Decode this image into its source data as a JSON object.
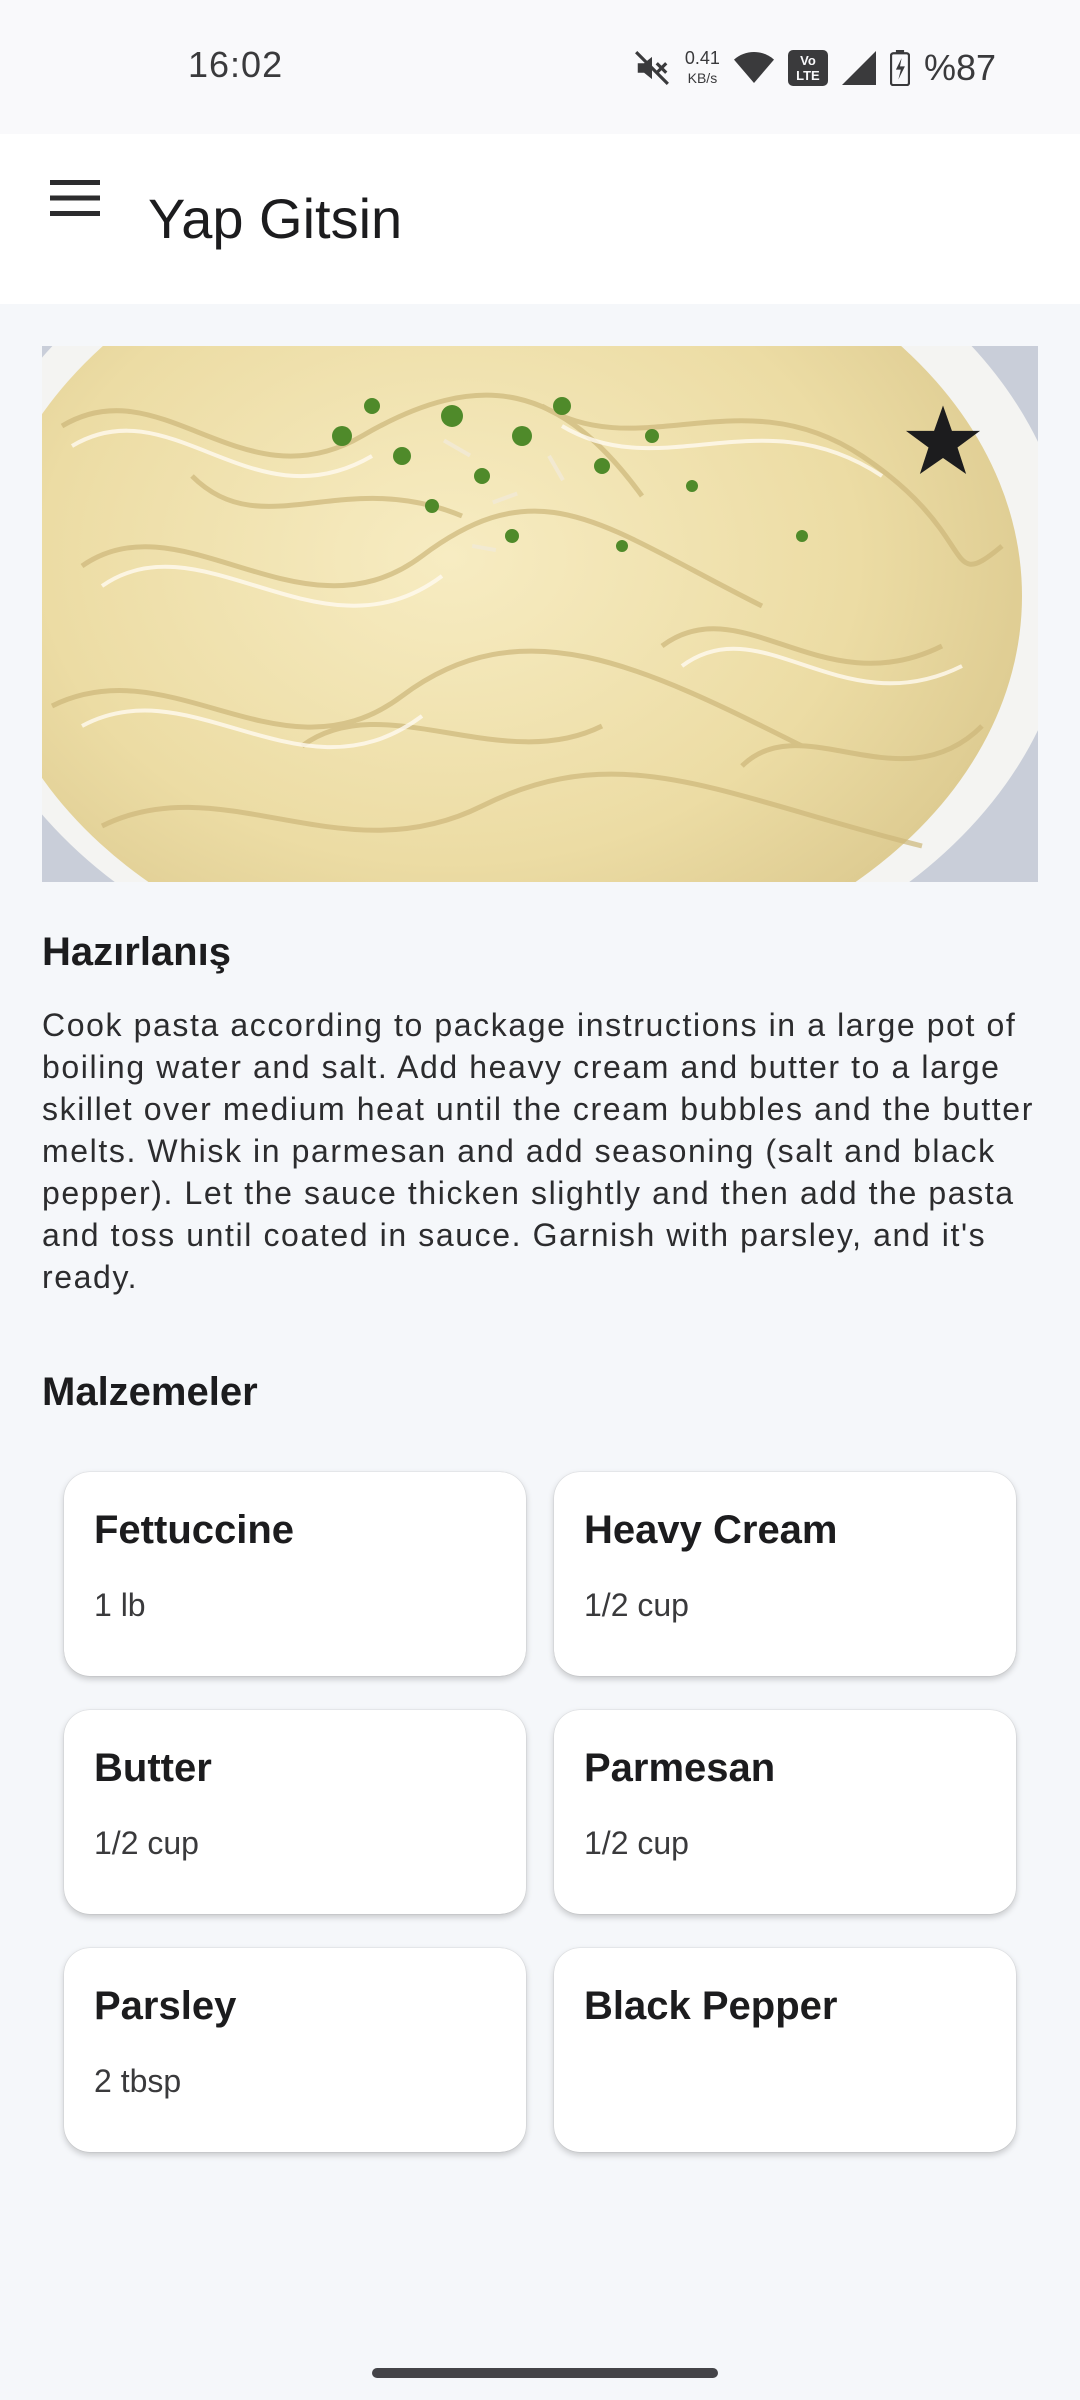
{
  "status_bar": {
    "time": "16:02",
    "net_speed_value": "0.41",
    "net_speed_unit": "KB/s",
    "volte_top": "Vo",
    "volte_bottom": "LTE",
    "battery": "%87"
  },
  "app_bar": {
    "title": "Yap Gitsin",
    "menu_icon": "hamburger-menu-icon"
  },
  "recipe": {
    "image_subject": "creamy fettuccine alfredo with parsley",
    "favorite_icon": "star-icon",
    "preparation_heading": "Hazırlanış",
    "preparation_text": "Cook pasta according to package instructions in a large pot of boiling water and salt. Add heavy cream and butter to a large skillet over medium heat until the cream bubbles and the butter melts. Whisk in parmesan and add seasoning (salt and black pepper). Let the sauce thicken slightly and then add the pasta and toss until coated in sauce. Garnish with parsley, and it's ready.",
    "ingredients_heading": "Malzemeler",
    "ingredients": [
      {
        "name": "Fettuccine",
        "amount": "1 lb"
      },
      {
        "name": "Heavy Cream",
        "amount": "1/2 cup"
      },
      {
        "name": "Butter",
        "amount": "1/2 cup"
      },
      {
        "name": "Parmesan",
        "amount": "1/2 cup"
      },
      {
        "name": "Parsley",
        "amount": "2 tbsp"
      },
      {
        "name": "Black Pepper",
        "amount": ""
      }
    ]
  },
  "colors": {
    "background": "#f5f7fa",
    "app_bar": "#ffffff",
    "text": "#1c1c1e",
    "card": "#ffffff"
  }
}
